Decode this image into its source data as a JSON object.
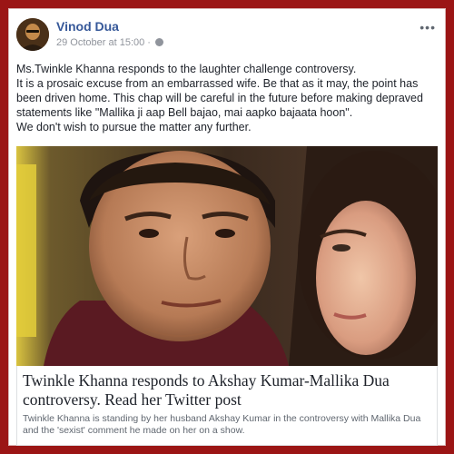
{
  "post": {
    "author": "Vinod Dua",
    "timestamp": "29 October at 15:00",
    "separator": "·",
    "privacy_icon": "globe-icon",
    "more_icon": "more-options-icon",
    "more_label": "•••",
    "lines": [
      "Ms.Twinkle Khanna responds to the laughter challenge controversy.",
      "It is a prosaic excuse from an embarrassed wife. Be that as it may, the point has been driven home. This chap will be careful in the future before making depraved statements like \"Mallika ji aap Bell bajao, mai aapko bajaata hoon\".",
      "We don't wish to pursue the matter any further."
    ]
  },
  "link": {
    "title": "Twinkle Khanna responds to Akshay Kumar-Mallika Dua controversy. Read her Twitter post",
    "description": "Twinkle Khanna is standing by her husband Akshay Kumar in the controversy with Mallika Dua and the 'sexist' comment he made on her on a show."
  },
  "colors": {
    "frame": "#9b1515",
    "author_link": "#365899",
    "meta_gray": "#90949c",
    "text": "#1d2129"
  }
}
